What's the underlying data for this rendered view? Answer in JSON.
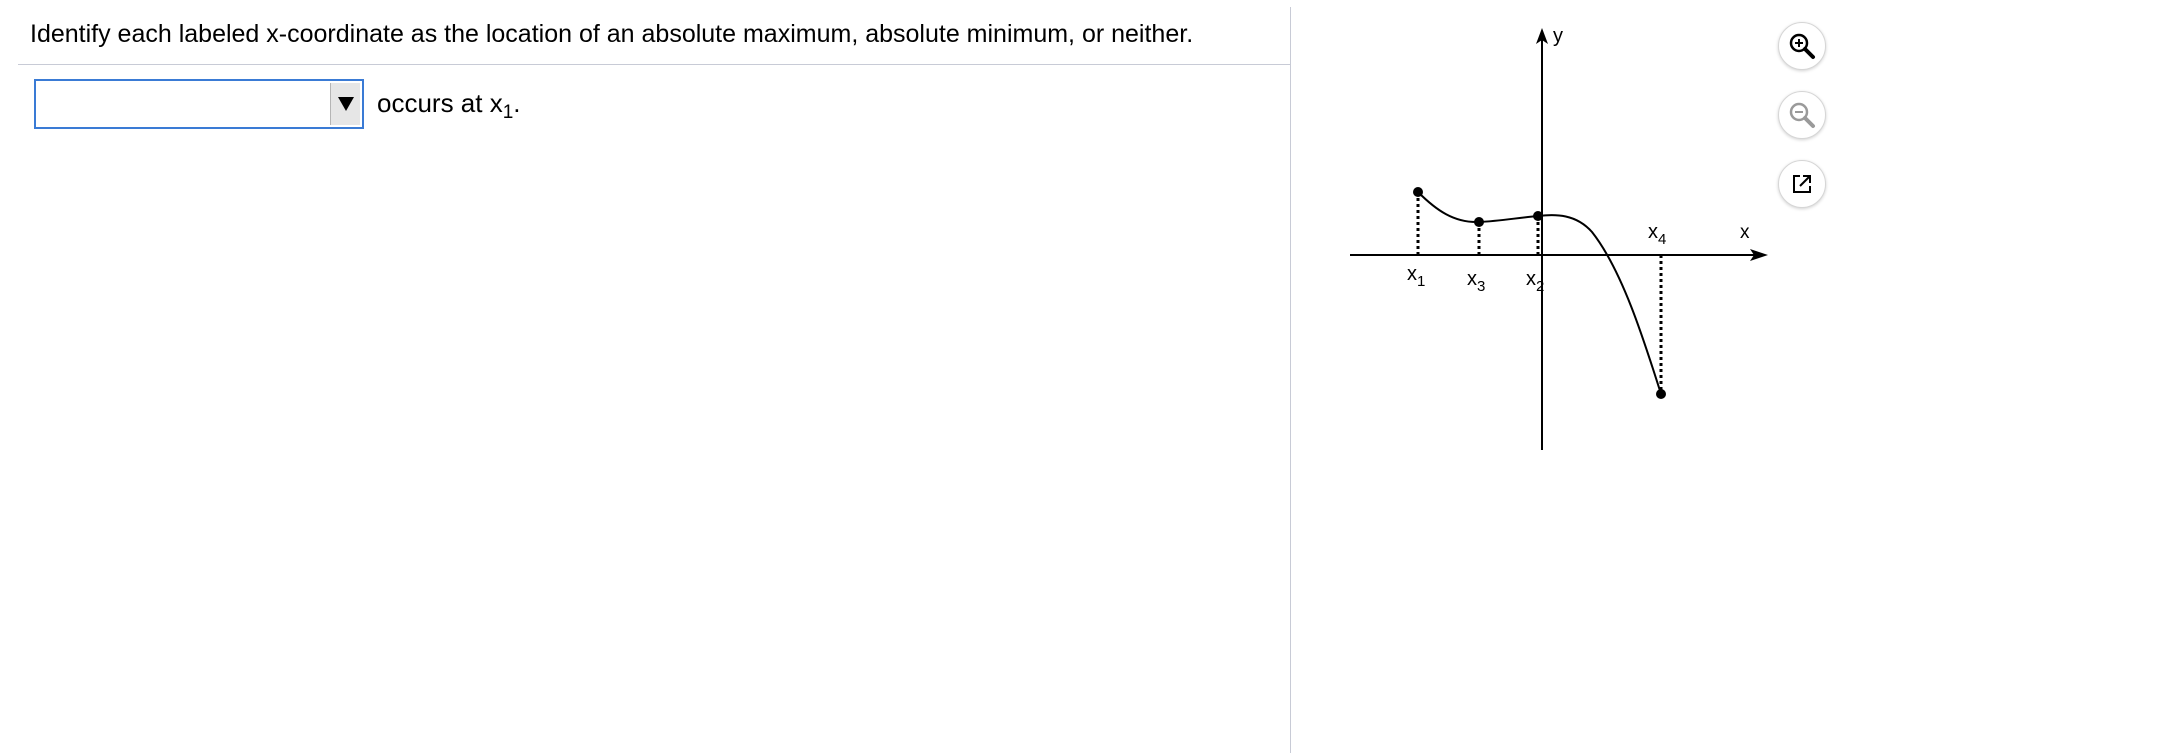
{
  "question": {
    "text": "Identify each labeled x-coordinate as the location of an absolute maximum, absolute minimum, or neither."
  },
  "answer": {
    "dropdown_value": "",
    "text_before_sub": "occurs at x",
    "subscript": "1",
    "text_after_sub": "."
  },
  "graph": {
    "y_axis_label": "y",
    "x_axis_label": "x",
    "point_labels": [
      {
        "main": "x",
        "sub": "1"
      },
      {
        "main": "x",
        "sub": "3"
      },
      {
        "main": "x",
        "sub": "2"
      },
      {
        "main": "x",
        "sub": "4"
      }
    ]
  },
  "tools": {
    "zoom_in": "zoom-in-icon",
    "zoom_out": "zoom-out-icon",
    "popout": "popout-icon"
  },
  "colors": {
    "dropdown_border": "#3a7bd5",
    "divider": "#c8cbd6"
  }
}
